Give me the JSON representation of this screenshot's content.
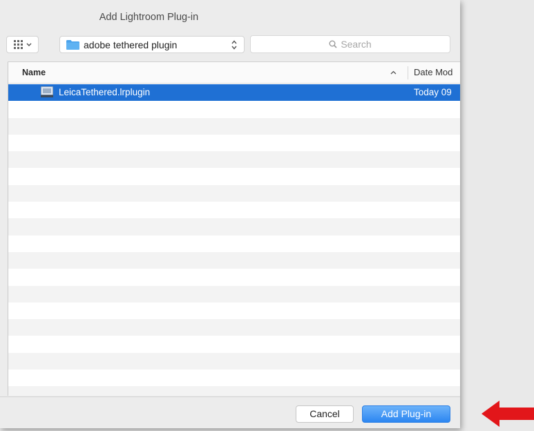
{
  "window": {
    "title": "Add Lightroom Plug-in"
  },
  "toolbar": {
    "view_icon": "grid-icon",
    "location": "adobe tethered plugin",
    "search_placeholder": "Search"
  },
  "columns": {
    "name": "Name",
    "date": "Date Mod"
  },
  "files": [
    {
      "name": "LeicaTethered.lrplugin",
      "date": "Today 09",
      "selected": true,
      "icon": "plugin-file-icon"
    }
  ],
  "buttons": {
    "cancel": "Cancel",
    "add": "Add Plug-in"
  },
  "colors": {
    "selection": "#1f70d4",
    "primary_button": "#2c86f1",
    "folder": "#4aa3ec",
    "arrow": "#e2161a"
  }
}
